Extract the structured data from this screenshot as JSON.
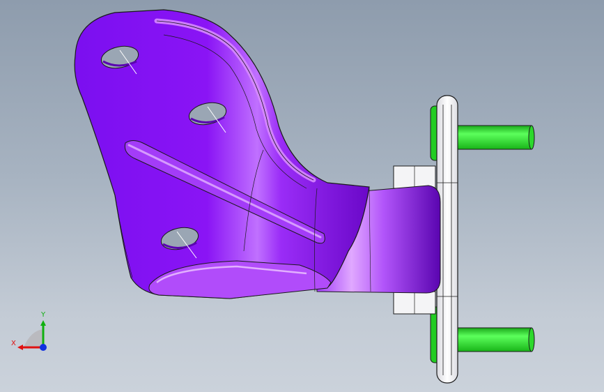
{
  "viewport": {
    "background_top": "#8e9cad",
    "background_bottom": "#cbd2db"
  },
  "model": {
    "bracket_color": "#8a14f5",
    "bracket_highlight": "#d98bff",
    "bracket_shadow": "#5f06b8",
    "plate_color": "#f2f2f4",
    "stud_color": "#22dd22",
    "edge_color": "#1a1a1a"
  },
  "triad": {
    "x_label": "X",
    "y_label": "Y",
    "x_color": "#e01010",
    "y_color": "#10b010",
    "z_color": "#1030e0"
  }
}
